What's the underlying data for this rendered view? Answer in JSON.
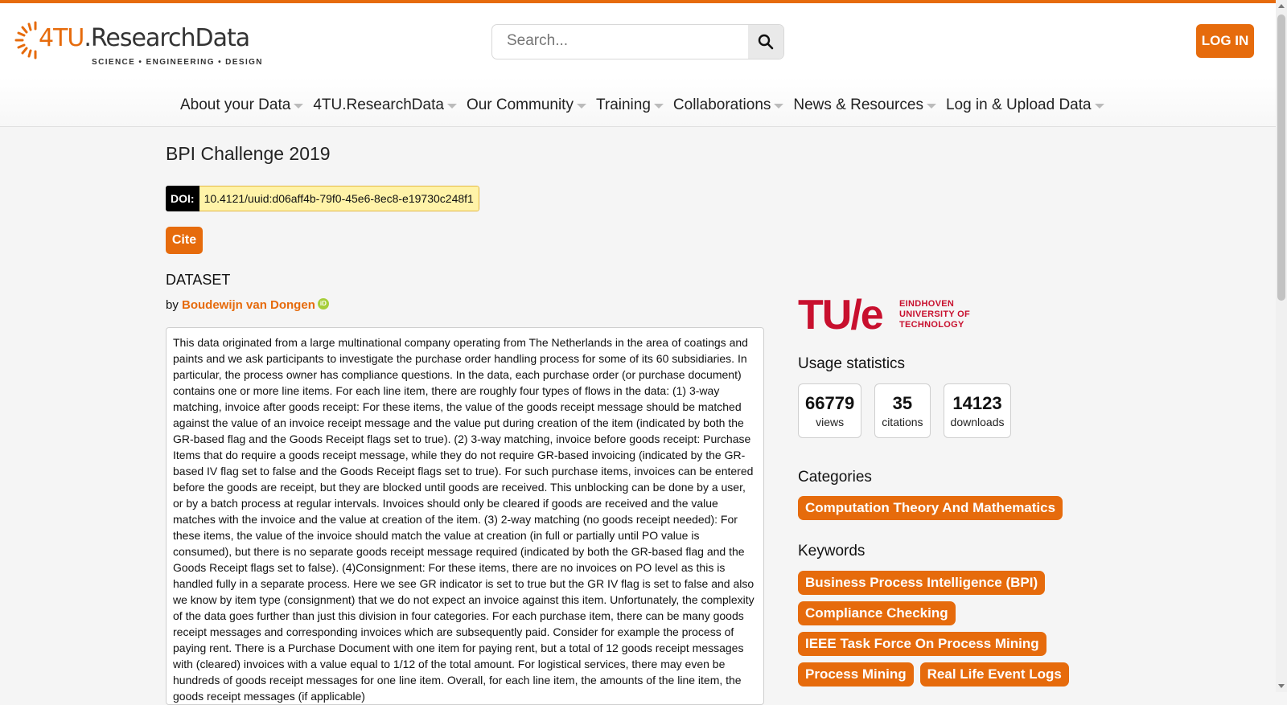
{
  "header": {
    "logo": {
      "brand_prefix": "4TU",
      "brand_suffix": ".ResearchData",
      "tagline": "SCIENCE • ENGINEERING • DESIGN"
    },
    "search": {
      "placeholder": "Search..."
    },
    "login_label": "LOG IN",
    "accent_color": "#e66b0c"
  },
  "nav": {
    "items": [
      {
        "label": "About your Data"
      },
      {
        "label": "4TU.ResearchData"
      },
      {
        "label": "Our Community"
      },
      {
        "label": "Training"
      },
      {
        "label": "Collaborations"
      },
      {
        "label": "News & Resources"
      },
      {
        "label": "Log in & Upload Data"
      }
    ]
  },
  "dataset": {
    "title": "BPI Challenge 2019",
    "doi_label": "DOI:",
    "doi_value": "10.4121/uuid:d06aff4b-79f0-45e6-8ec8-e19730c248f1",
    "cite_label": "Cite",
    "type": "DATASET",
    "by_prefix": "by",
    "author": "Boudewijn van Dongen",
    "orcid_icon": "orcid-icon",
    "description": "This data originated from a large multinational company operating from The Netherlands in the area of coatings and paints and we ask participants to investigate the purchase order handling process for some of its 60 subsidiaries. In particular, the process owner has compliance questions. In the data, each purchase order (or purchase document) contains one or more line items. For each line item, there are roughly four types of flows in the data: (1) 3-way matching, invoice after goods receipt: For these items, the value of the goods receipt message should be matched against the value of an invoice receipt message and the value put during creation of the item (indicated by both the GR-based flag and the Goods Receipt flags set to true). (2) 3-way matching, invoice before goods receipt: Purchase Items that do require a goods receipt message, while they do not require GR-based invoicing (indicated by the GR-based IV flag set to false and the Goods Receipt flags set to true). For such purchase items, invoices can be entered before the goods are receipt, but they are blocked until goods are received. This unblocking can be done by a user, or by a batch process at regular intervals. Invoices should only be cleared if goods are received and the value matches with the invoice and the value at creation of the item. (3) 2-way matching (no goods receipt needed): For these items, the value of the invoice should match the value at creation (in full or partially until PO value is consumed), but there is no separate goods receipt message required (indicated by both the GR-based flag and the Goods Receipt flags set to false). (4)Consignment: For these items, there are no invoices on PO level as this is handled fully in a separate process. Here we see GR indicator is set to true but the GR IV flag is set to false and also we know by item type (consignment) that we do not expect an invoice against this item. Unfortunately, the complexity of the data goes further than just this division in four categories. For each purchase item, there can be many goods receipt messages and corresponding invoices which are subsequently paid. Consider for example the process of paying rent. There is a Purchase Document with one item for paying rent, but a total of 12 goods receipt messages with (cleared) invoices with a value equal to 1/12 of the total amount. For logistical services, there may even be hundreds of goods receipt messages for one line item. Overall, for each line item, the amounts of the line item, the goods receipt messages (if applicable)"
  },
  "sidebar": {
    "institution": {
      "mark": "TU/e",
      "name_line1": "EINDHOVEN",
      "name_line2": "UNIVERSITY OF",
      "name_line3": "TECHNOLOGY",
      "color": "#c8102e"
    },
    "usage_title": "Usage statistics",
    "stats": [
      {
        "value": "66779",
        "label": "views"
      },
      {
        "value": "35",
        "label": "citations"
      },
      {
        "value": "14123",
        "label": "downloads"
      }
    ],
    "categories_title": "Categories",
    "categories": [
      "Computation Theory And Mathematics"
    ],
    "keywords_title": "Keywords",
    "keywords": [
      "Business Process Intelligence (BPI)",
      "Compliance Checking",
      "IEEE Task Force On Process Mining",
      "Process Mining",
      "Real Life Event Logs"
    ]
  }
}
